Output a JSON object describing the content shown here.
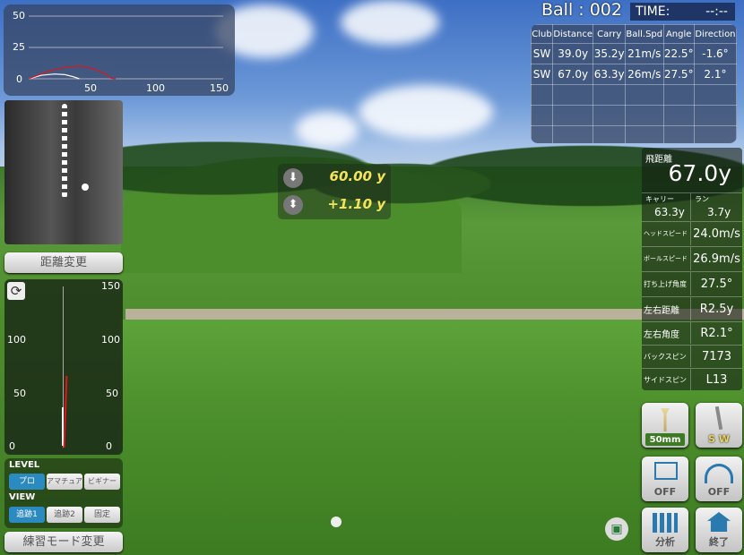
{
  "trajectory_chart": {
    "y_ticks": [
      "50",
      "25",
      "0"
    ],
    "x_ticks": [
      "50",
      "100",
      "150"
    ],
    "xlim": [
      0,
      150
    ],
    "ylim": [
      0,
      50
    ],
    "series": [
      {
        "color": "#ffffff",
        "points": [
          [
            0,
            0
          ],
          [
            10,
            2.8
          ],
          [
            20,
            3.8
          ],
          [
            28,
            3.3
          ],
          [
            35,
            1.5
          ],
          [
            39,
            0
          ]
        ]
      },
      {
        "color": "#e0141e",
        "points": [
          [
            0,
            0
          ],
          [
            15,
            6
          ],
          [
            30,
            9.5
          ],
          [
            40,
            10.2
          ],
          [
            50,
            8
          ],
          [
            60,
            3.5
          ],
          [
            63.3,
            0.5
          ],
          [
            67,
            0
          ]
        ]
      }
    ]
  },
  "distance_change_label": "距離変更",
  "direction_gauge": {
    "left_ticks": [
      "100",
      "50",
      "0"
    ],
    "right_ticks": [
      "150",
      "100",
      "50",
      "0"
    ],
    "refresh_icon": "refresh-icon"
  },
  "level": {
    "title": "LEVEL",
    "options": [
      "プロ",
      "アマチュア",
      "ビギナー"
    ],
    "selected": 0
  },
  "view": {
    "title": "VIEW",
    "options": [
      "追跡1",
      "追跡2",
      "固定"
    ],
    "selected": 0
  },
  "practice_mode_label": "練習モード変更",
  "ball_label": "Ball : 002",
  "time": {
    "label": "TIME:",
    "value": "--:--"
  },
  "shot_table": {
    "headers": [
      "Club",
      "Distance",
      "Carry",
      "Ball.Spd",
      "Angle",
      "Direction"
    ],
    "rows": [
      [
        "SW",
        "39.0y",
        "35.2y",
        "21m/s",
        "22.5°",
        "-1.6°"
      ],
      [
        "SW",
        "67.0y",
        "63.3y",
        "26m/s",
        "27.5°",
        "2.1°"
      ]
    ]
  },
  "target": {
    "distance": "60.00 y",
    "elevation": "+1.10 y"
  },
  "stats": {
    "flight_label": "飛距離",
    "flight_value": "67.0y",
    "carry_label": "キャリー",
    "carry_value": "63.3y",
    "run_label": "ラン",
    "run_value": "3.7y",
    "rows": [
      [
        "ヘッドスピード",
        "24.0m/s"
      ],
      [
        "ボールスピード",
        "26.9m/s"
      ],
      [
        "打ち上げ角度",
        "27.5°"
      ],
      [
        "左右距離",
        "R2.5y"
      ],
      [
        "左右角度",
        "R2.1°"
      ],
      [
        "バックスピン",
        "7173"
      ],
      [
        "サイドスピン",
        "L13"
      ]
    ]
  },
  "buttons": {
    "tee": "50mm",
    "club": "S W",
    "replay": "OFF",
    "curve": "OFF",
    "analysis": "分析",
    "exit": "終了"
  },
  "accent": "#2b8ac0"
}
